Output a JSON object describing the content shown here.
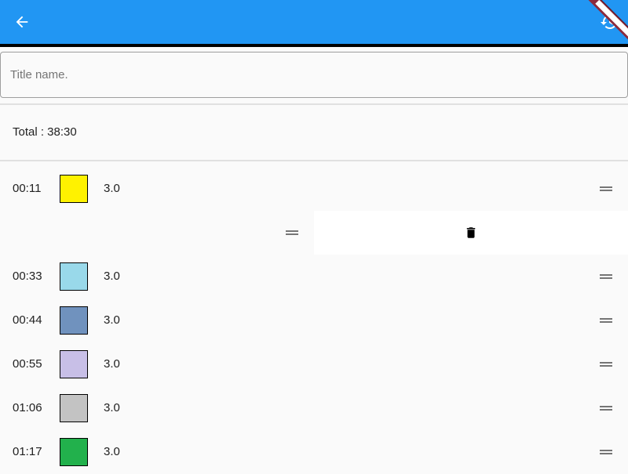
{
  "appbar": {
    "back_icon": "arrow-back-icon",
    "restore_icon": "restore-icon",
    "color": "#2196f3"
  },
  "title_field": {
    "placeholder": "Title name.",
    "value": ""
  },
  "total": {
    "text": "Total : 38:30"
  },
  "rows": [
    {
      "time": "00:11",
      "color": "#fff200",
      "value": "3.0"
    },
    {
      "time": "00:33",
      "color": "#99d9ea",
      "value": "3.0"
    },
    {
      "time": "00:44",
      "color": "#7092be",
      "value": "3.0"
    },
    {
      "time": "00:55",
      "color": "#c8bfe7",
      "value": "3.0"
    },
    {
      "time": "01:06",
      "color": "#c3c3c3",
      "value": "3.0"
    },
    {
      "time": "01:17",
      "color": "#22b14c",
      "value": "3.0"
    }
  ],
  "dragging_row": {
    "delete_icon": "delete-icon",
    "handle_icon": "drag-handle-icon"
  }
}
